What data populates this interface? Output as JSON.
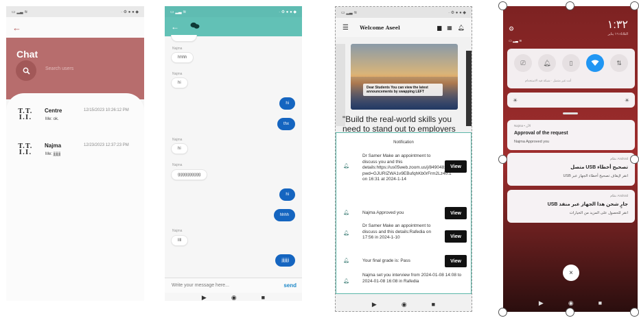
{
  "phone1": {
    "title": "Chat",
    "search_placeholder": "Search users",
    "chats": [
      {
        "avatar": "T.T.\nI.I.",
        "name": "Centre",
        "last": "Me: ok.",
        "time": "12/15/2023 10:26:12 PM"
      },
      {
        "avatar": "T.T.\nI.I.",
        "name": "Najma",
        "last": "Me: jjjjjjjj",
        "time": "12/23/2023 12:37:23 PM"
      }
    ]
  },
  "phone2": {
    "messages": [
      {
        "side": "in",
        "sender": "Najma",
        "text": "hhhh"
      },
      {
        "side": "in",
        "sender": "Najma",
        "text": "hi"
      },
      {
        "side": "out",
        "text": "hi"
      },
      {
        "side": "out",
        "text": "thx"
      },
      {
        "side": "in",
        "sender": "Najma",
        "text": "hi"
      },
      {
        "side": "in",
        "sender": "Najma",
        "text": "gggggggggg"
      },
      {
        "side": "out",
        "text": "hi"
      },
      {
        "side": "out",
        "text": "hhhh"
      },
      {
        "side": "in",
        "sender": "Najma",
        "text": "llll"
      },
      {
        "side": "out",
        "text": "jjjjjjjj"
      }
    ],
    "composer_placeholder": "Write your message here...",
    "send_label": "send"
  },
  "phone3": {
    "welcome": "Welcome Aseel",
    "banner_text": "Dear Students You can view the latest announcements by swapping LEFT",
    "tagline": "\"Build the real-world skills you need to stand out to employers",
    "notification_heading": "Notification",
    "view_label": "View",
    "notifications": [
      {
        "text": "Dr Samer Make an appointment to discuss you and this details:https://us05web.zoom.us/j/84904828133?pwd=GJURIZWA1v9EBufqhKb0rFrm2Lz40.1 on 16:31 at 2024-1-14",
        "has_button": true
      },
      {
        "text": "Najma Approved you",
        "has_button": true
      },
      {
        "text": "Dr Samer Make an appointment to discuss and this details:Rafedia on 17:56 in 2024-1-10",
        "has_button": true
      },
      {
        "text": "Your final grade is: Pass",
        "has_button": true
      },
      {
        "text": "Najma set you interview from 2024-01-08 14:08 to 2024-01-08 16:08 in Rafedia",
        "has_button": false
      }
    ]
  },
  "phone4": {
    "clock": "١:٣٢",
    "date": "الثلاثاء ١٦ يناير",
    "qs_note": "أنت غير متصل  ·  شبكة قيد الاستخدام",
    "notif_app": "Najma • الآن",
    "notif_title": "Approval of the request",
    "notif_body": "Najma Approved you",
    "usb1_app": "Android نظام",
    "usb1_title": "تصحيح أخطاء USB متصل",
    "usb1_body": "انقر لإيقاف تصحيح أخطاء الجهاز عبر USB",
    "usb2_app": "Android نظام",
    "usb2_title": "جارٍ شحن هذا الجهاز عبر منفذ USB",
    "usb2_body": "انقر للحصول على المزيد من الخيارات",
    "close_label": "×"
  },
  "colors": {
    "chat_header": "#b76d6d",
    "teal": "#62c1b6",
    "bubble_out": "#1565c0",
    "wifi_active": "#2196f3"
  }
}
